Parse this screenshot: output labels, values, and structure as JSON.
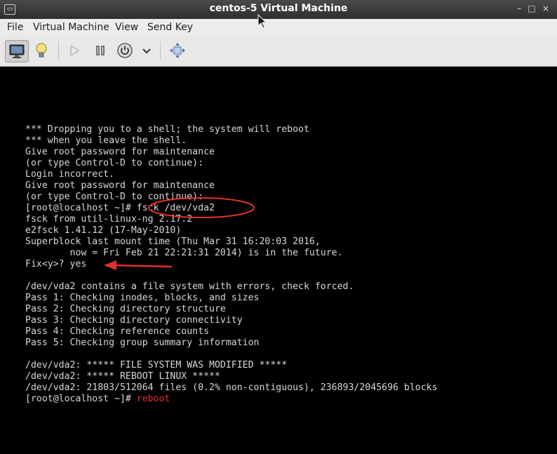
{
  "window": {
    "title": "centos-5 Virtual Machine",
    "minimize_glyph": "–",
    "maximize_glyph": "□",
    "close_glyph": "×"
  },
  "menu": [
    "File",
    "Virtual Machine",
    "View",
    "Send Key"
  ],
  "toolbar": {
    "icons": [
      "console-icon",
      "details-lightbulb-icon",
      "run-icon",
      "pause-icon",
      "power-icon",
      "chevron-down-icon",
      "fullscreen-icon"
    ]
  },
  "terminal": {
    "lines": [
      "*** Dropping you to a shell; the system will reboot",
      "*** when you leave the shell.",
      "Give root password for maintenance",
      "(or type Control-D to continue):",
      "Login incorrect.",
      "Give root password for maintenance",
      "(or type Control-D to continue):",
      "[root@localhost ~]# fsck /dev/vda2",
      "fsck from util-linux-ng 2.17.2",
      "e2fsck 1.41.12 (17-May-2010)",
      "Superblock last mount time (Thu Mar 31 16:20:03 2016,",
      "        now = Fri Feb 21 22:21:31 2014) is in the future.",
      "Fix<y>? yes",
      "",
      "/dev/vda2 contains a file system with errors, check forced.",
      "Pass 1: Checking inodes, blocks, and sizes",
      "Pass 2: Checking directory structure",
      "Pass 3: Checking directory connectivity",
      "Pass 4: Checking reference counts",
      "Pass 5: Checking group summary information",
      "",
      "/dev/vda2: ***** FILE SYSTEM WAS MODIFIED *****",
      "/dev/vda2: ***** REBOOT LINUX *****",
      "/dev/vda2: 21803/512064 files (0.2% non-contiguous), 236893/2045696 blocks"
    ],
    "prompt": "[root@localhost ~]# ",
    "typed_command": "reboot"
  },
  "colors": {
    "annotation": "#e62e2e",
    "terminal_text": "#d8d8d8",
    "background": "#000000"
  }
}
